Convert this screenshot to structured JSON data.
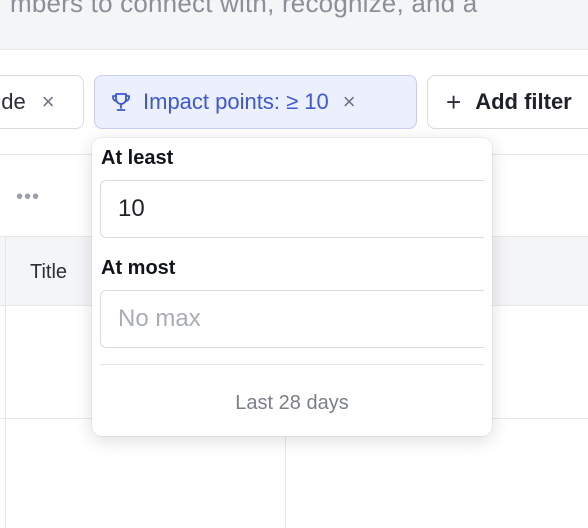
{
  "header": {
    "subtitle": "mbers to connect with, recognize, and a"
  },
  "filters": {
    "exclude_chip": {
      "label": "ude",
      "remove": "×"
    },
    "impact_chip": {
      "label": "Impact points: ≥ 10",
      "remove": "×",
      "icon": "trophy-icon"
    },
    "add_filter": {
      "label": "Add filter",
      "icon": "plus-icon",
      "glyph": "+"
    }
  },
  "table": {
    "more_menu": "•••",
    "columns": [
      "Title"
    ]
  },
  "popover": {
    "min_label": "At least",
    "min_value": "10",
    "max_label": "At most",
    "max_placeholder": "No max",
    "footer": "Last 28 days"
  },
  "colors": {
    "accent": "#3b58d9",
    "chip_active_bg": "#eceffc",
    "header_bg": "#f4f5f7"
  }
}
